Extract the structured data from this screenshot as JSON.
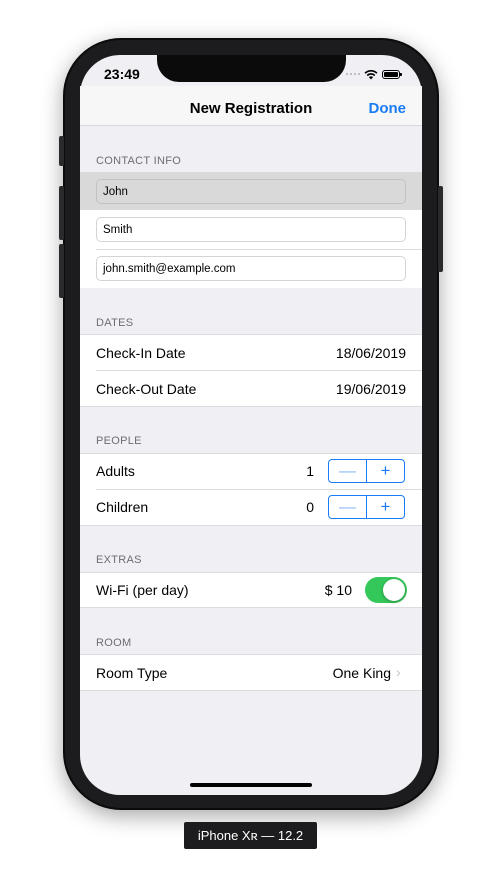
{
  "status_bar": {
    "time": "23:49"
  },
  "nav": {
    "title": "New Registration",
    "done_label": "Done"
  },
  "contact": {
    "header": "CONTACT INFO",
    "first_name": "John",
    "last_name": "Smith",
    "email": "john.smith@example.com"
  },
  "dates": {
    "header": "DATES",
    "check_in_label": "Check-In Date",
    "check_in_value": "18/06/2019",
    "check_out_label": "Check-Out Date",
    "check_out_value": "19/06/2019"
  },
  "people": {
    "header": "PEOPLE",
    "adults_label": "Adults",
    "adults_value": "1",
    "children_label": "Children",
    "children_value": "0",
    "minus": "—",
    "plus": "+"
  },
  "extras": {
    "header": "EXTRAS",
    "wifi_label": "Wi-Fi (per day)",
    "wifi_price": "$ 10",
    "wifi_enabled": true
  },
  "room": {
    "header": "ROOM",
    "type_label": "Room Type",
    "type_value": "One King",
    "chevron": "›"
  },
  "device_label": "iPhone Xʀ — 12.2",
  "colors": {
    "accent": "#1a7cf5",
    "toggle_on": "#34c759",
    "background": "#efeff4"
  }
}
